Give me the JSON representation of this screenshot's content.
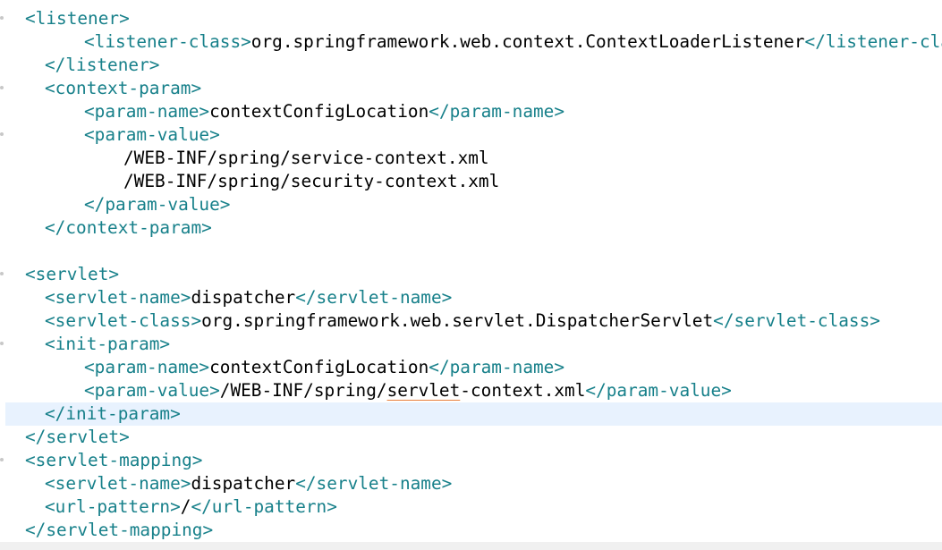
{
  "editor": {
    "lines": [
      {
        "indent": 1,
        "tag_open": "<listener>",
        "text": "",
        "tag_close": "",
        "fold": true
      },
      {
        "indent": 2,
        "tag_open": "<listener-class>",
        "text": "org.springframework.web.context.ContextLoaderListener",
        "tag_close": "</listener-class>",
        "fold": false
      },
      {
        "indent": 3,
        "tag_open": "</listener>",
        "text": "",
        "tag_close": "",
        "fold": false
      },
      {
        "indent": 3,
        "tag_open": "<context-param>",
        "text": "",
        "tag_close": "",
        "fold": true
      },
      {
        "indent": 2,
        "tag_open": "<param-name>",
        "text": "contextConfigLocation",
        "tag_close": "</param-name>",
        "fold": false
      },
      {
        "indent": 2,
        "tag_open": "<param-value>",
        "text": "",
        "tag_close": "",
        "fold": true
      },
      {
        "indent": 4,
        "tag_open": "",
        "text": "/WEB-INF/spring/service-context.xml",
        "tag_close": "",
        "fold": false
      },
      {
        "indent": 4,
        "tag_open": "",
        "text": "/WEB-INF/spring/security-context.xml",
        "tag_close": "",
        "fold": false
      },
      {
        "indent": 2,
        "tag_open": "</param-value>",
        "text": "",
        "tag_close": "",
        "fold": false
      },
      {
        "indent": 3,
        "tag_open": "</context-param>",
        "text": "",
        "tag_close": "",
        "fold": false
      },
      {
        "indent": 0,
        "tag_open": "",
        "text": "",
        "tag_close": "",
        "fold": false
      },
      {
        "indent": 1,
        "tag_open": "<servlet>",
        "text": "",
        "tag_close": "",
        "fold": true
      },
      {
        "indent": 3,
        "tag_open": "<servlet-name>",
        "text": "dispatcher",
        "tag_close": "</servlet-name>",
        "fold": false
      },
      {
        "indent": 3,
        "tag_open": "<servlet-class>",
        "text": "org.springframework.web.servlet.DispatcherServlet",
        "tag_close": "</servlet-class>",
        "fold": false
      },
      {
        "indent": 3,
        "tag_open": "<init-param>",
        "text": "",
        "tag_close": "",
        "fold": true
      },
      {
        "indent": 2,
        "tag_open": "<param-name>",
        "text": "contextConfigLocation",
        "tag_close": "</param-name>",
        "fold": false
      },
      {
        "indent": 2,
        "tag_open": "<param-value>",
        "text": "/WEB-INF/spring/",
        "squiggle_text": "servlet",
        "text_after": "-context.xml",
        "tag_close": "</param-value>",
        "fold": false
      },
      {
        "indent": 3,
        "tag_open": "</init-param>",
        "text": "",
        "tag_close": "",
        "fold": false,
        "highlight": true
      },
      {
        "indent": 1,
        "tag_open": "</servlet>",
        "text": "",
        "tag_close": "",
        "fold": false
      },
      {
        "indent": 1,
        "tag_open": "<servlet-mapping>",
        "text": "",
        "tag_close": "",
        "fold": true
      },
      {
        "indent": 3,
        "tag_open": "<servlet-name>",
        "text": "dispatcher",
        "tag_close": "</servlet-name>",
        "fold": false
      },
      {
        "indent": 3,
        "tag_open": "<url-pattern>",
        "text": "/",
        "tag_close": "</url-pattern>",
        "fold": false
      },
      {
        "indent": 1,
        "tag_open": "</servlet-mapping>",
        "text": "",
        "tag_close": "",
        "fold": false
      }
    ]
  },
  "colors": {
    "tag": "#17808a",
    "text": "#000000",
    "current_line": "#e8f2fe",
    "squiggle": "#e8803c"
  }
}
